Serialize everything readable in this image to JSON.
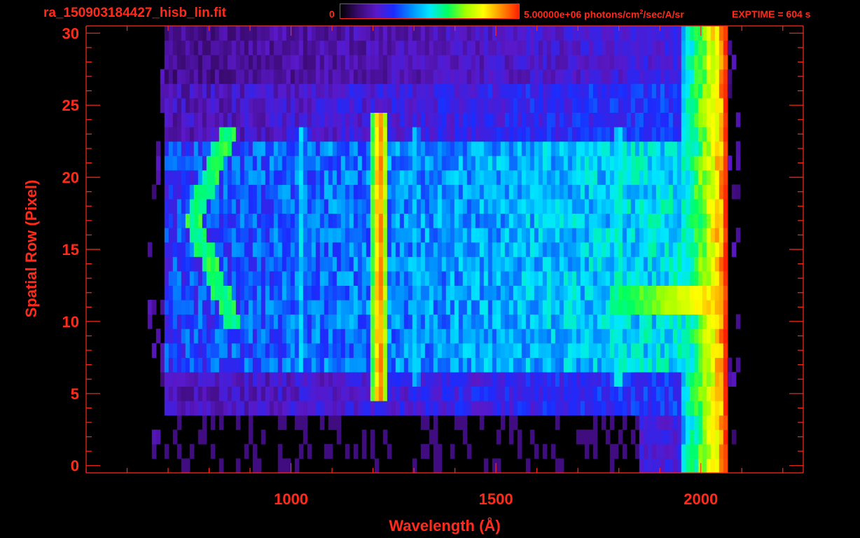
{
  "header": {
    "file_name": "ra_150903184427_hisb_lin.fit",
    "colorbar_min": "0",
    "colorbar_max_pre": "5.00000e+06 photons/cm",
    "colorbar_max_sup": "2",
    "colorbar_max_post": "/sec/A/sr",
    "exptime": "EXPTIME = 604 s"
  },
  "colors": {
    "axis": "#ff2a1a",
    "background": "#000000",
    "colormap": [
      "#000000",
      "#3a0a6e",
      "#5a18c8",
      "#1a2cff",
      "#0090ff",
      "#00e8ff",
      "#00ff60",
      "#a0ff00",
      "#ffff00",
      "#ff9000",
      "#ff2000"
    ]
  },
  "chart_data": {
    "type": "heatmap",
    "title": "",
    "xlabel": "Wavelength (Å)",
    "ylabel": "Spatial Row (Pixel)",
    "xlim": [
      500,
      2250
    ],
    "ylim": [
      -0.5,
      30.5
    ],
    "x_ticks": [
      1000,
      1500,
      2000
    ],
    "y_ticks": [
      0,
      5,
      10,
      15,
      20,
      25,
      30
    ],
    "x_minor_step": 100,
    "y_minor_step": 1,
    "grid": false,
    "colorbar": {
      "min": 0,
      "max": 5000000,
      "units": "photons/cm^2/sec/A/sr",
      "position": "top"
    },
    "spectral_range_angstrom": [
      690,
      2070
    ],
    "emission_features_angstrom": [
      {
        "wavelength": 1025,
        "rows": [
          7,
          23
        ],
        "relative_intensity": 0.45
      },
      {
        "wavelength": 1216,
        "rows": [
          5,
          24
        ],
        "relative_intensity": 0.9
      },
      {
        "wavelength": 1304,
        "rows": [
          6,
          23
        ],
        "relative_intensity": 0.45
      },
      {
        "wavelength": 1800,
        "rows": [
          6,
          23
        ],
        "relative_intensity": 0.55
      },
      {
        "wavelength": 2060,
        "rows": [
          0,
          30
        ],
        "relative_intensity": 0.95
      }
    ],
    "bright_band": {
      "rows": [
        11,
        12
      ],
      "wavelength_range": [
        1780,
        2070
      ],
      "relative_intensity": 0.85
    },
    "arc_feature": {
      "wavelength_range": [
        760,
        900
      ],
      "rows": [
        10,
        23
      ],
      "relative_intensity": 0.55
    }
  }
}
